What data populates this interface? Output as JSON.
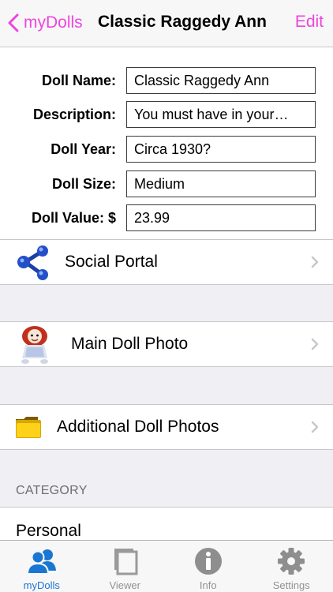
{
  "nav": {
    "back_label": "myDolls",
    "title": "Classic Raggedy Ann",
    "edit_label": "Edit",
    "accent": "#ee44dd"
  },
  "form": {
    "fields": [
      {
        "label": "Doll Name:",
        "value": "Classic Raggedy Ann"
      },
      {
        "label": "Description:",
        "value": "You must have in your…"
      },
      {
        "label": "Doll Year:",
        "value": "Circa 1930?"
      },
      {
        "label": "Doll Size:",
        "value": "Medium"
      },
      {
        "label": "Doll Value: $",
        "value": "23.99"
      }
    ]
  },
  "cells": {
    "social": {
      "label": "Social Portal",
      "icon": "share-network-icon"
    },
    "main_photo": {
      "label": "Main Doll Photo",
      "icon": "doll-photo-icon"
    },
    "additional_photos": {
      "label": "Additional Doll Photos",
      "icon": "folder-icon"
    }
  },
  "category": {
    "header": "CATEGORY",
    "value": "Personal"
  },
  "tabbar": {
    "tabs": [
      {
        "label": "myDolls",
        "icon": "people-icon"
      },
      {
        "label": "Viewer",
        "icon": "pages-icon"
      },
      {
        "label": "Info",
        "icon": "info-icon"
      },
      {
        "label": "Settings",
        "icon": "gear-icon"
      }
    ],
    "active_color": "#1a76d2"
  }
}
